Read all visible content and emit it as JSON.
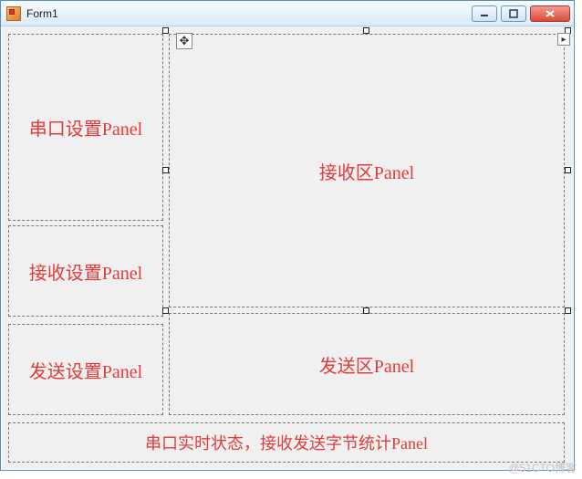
{
  "window": {
    "title": "Form1"
  },
  "panels": {
    "serial_settings": {
      "label": "串口设置Panel"
    },
    "recv_settings": {
      "label": "接收设置Panel"
    },
    "send_settings": {
      "label": "发送设置Panel"
    },
    "recv_area": {
      "label": "接收区Panel"
    },
    "send_area": {
      "label": "发送区Panel"
    },
    "status_bar": {
      "label": "串口实时状态，接收发送字节统计Panel"
    }
  },
  "watermark": "@51CTO博客",
  "designer": {
    "selected_panel": "recv_area"
  }
}
